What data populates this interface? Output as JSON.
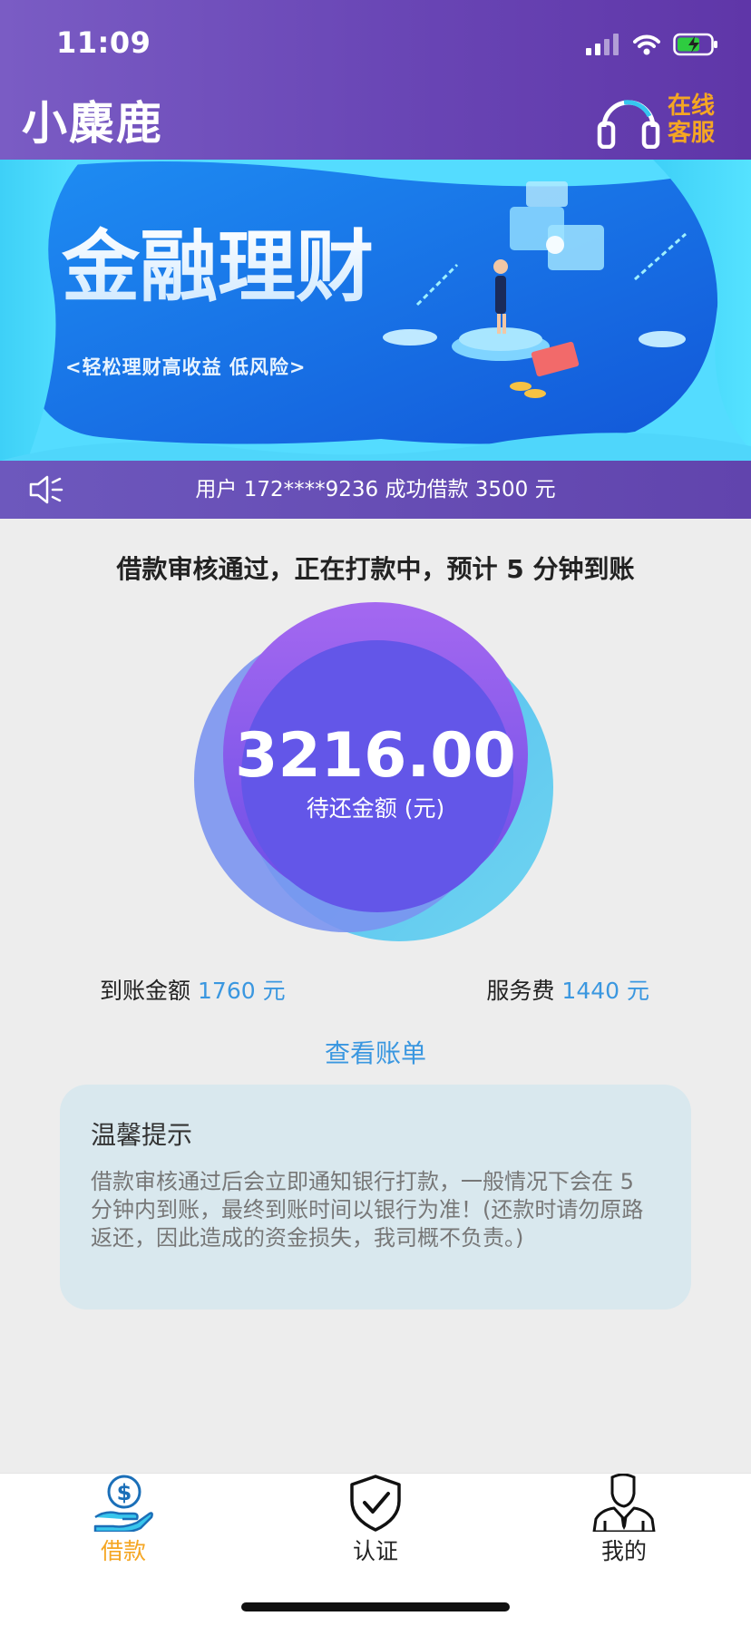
{
  "status_bar": {
    "time": "11:09"
  },
  "app_bar": {
    "title": "小麋鹿",
    "support_label": "在线客服"
  },
  "banner": {
    "headline": "金融理财",
    "subline": "<轻松理财高收益  低风险>"
  },
  "notice": {
    "text": "用户 172****9236 成功借款 3500 元"
  },
  "loan": {
    "status_text": "借款审核通过，正在打款中，预计 5 分钟到账",
    "amount": "3216.00",
    "amount_label": "待还金额 (元)",
    "received_label": "到账金额",
    "received_value": "1760 元",
    "fee_label": "服务费",
    "fee_value": "1440 元",
    "view_bill": "查看账单"
  },
  "tips": {
    "title": "温馨提示",
    "body": "借款审核通过后会立即通知银行打款，一般情况下会在 5 分钟内到账，最终到账时间以银行为准！(还款时请勿原路返还，因此造成的资金损失，我司概不负责。)"
  },
  "tabbar": {
    "items": [
      {
        "label": "借款",
        "icon": "loan-hand-dollar-icon",
        "active": true
      },
      {
        "label": "认证",
        "icon": "shield-check-icon",
        "active": false
      },
      {
        "label": "我的",
        "icon": "person-suit-icon",
        "active": false
      }
    ]
  },
  "colors": {
    "header": "#6a47b6",
    "accent_orange": "#f5a623",
    "link_blue": "#3a97e0",
    "circle_purple": "#6356e8",
    "tips_bg": "#d9e8ee"
  }
}
